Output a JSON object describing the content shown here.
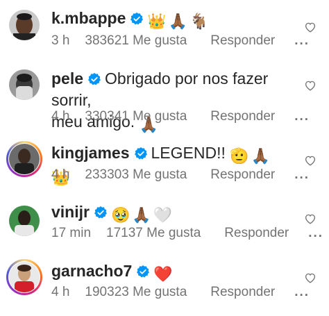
{
  "accent": "#0095f6",
  "comments": [
    {
      "username": "k.mbappe",
      "text": "",
      "emojis": [
        "👑",
        "🙏🏾",
        "🐐"
      ],
      "time": "3 h",
      "likes": "383621 Me gusta",
      "reply": "Responder",
      "more": "...",
      "avatar": "mbappe-avatar"
    },
    {
      "username": "pele",
      "text": "Obrigado por nos fazer sorrir,",
      "text2": "meu amigo.",
      "emojis": [
        "🙏🏾"
      ],
      "time": "4 h",
      "likes": "330341 Me gusta",
      "reply": "Responder",
      "more": "...",
      "avatar": "pele-avatar"
    },
    {
      "username": "kingjames",
      "text": "LEGEND!!",
      "emojis": [
        "🫡",
        "🙏🏾",
        "👑"
      ],
      "time": "4 h",
      "likes": "233303 Me gusta",
      "reply": "Responder",
      "more": "...",
      "avatar": "kingjames-avatar"
    },
    {
      "username": "vinijr",
      "text": "",
      "emojis": [
        "🥹",
        "🙏🏾",
        "🤍"
      ],
      "time": "17 min",
      "likes": "17137 Me gusta",
      "reply": "Responder",
      "more": "...",
      "avatar": "vinijr-avatar"
    },
    {
      "username": "garnacho7",
      "text": "",
      "emojis": [
        "❤️"
      ],
      "time": "4 h",
      "likes": "190323 Me gusta",
      "reply": "Responder",
      "more": "...",
      "avatar": "garnacho-avatar"
    }
  ]
}
